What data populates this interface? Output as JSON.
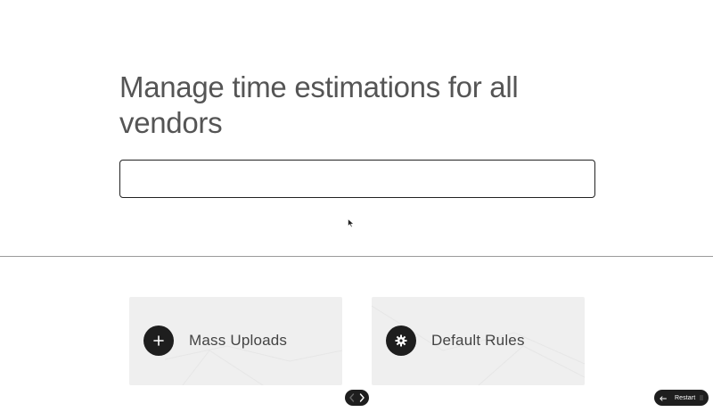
{
  "hero": {
    "title": "Manage time estimations for all vendors"
  },
  "search": {
    "value": "",
    "placeholder": ""
  },
  "cards": [
    {
      "label": "Mass Uploads",
      "icon": "plus-icon"
    },
    {
      "label": "Default Rules",
      "icon": "gear-icon"
    }
  ],
  "footer": {
    "restart_label": "Restart"
  },
  "colors": {
    "accent": "#1e1e1e",
    "card_bg": "#efefef",
    "divider": "#9a9a9a"
  }
}
